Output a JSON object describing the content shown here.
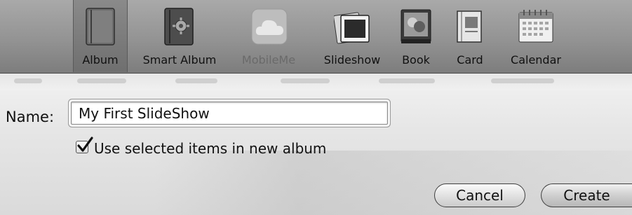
{
  "toolbar": {
    "items": [
      {
        "label": "Album",
        "icon": "album-icon",
        "selected": true,
        "enabled": true
      },
      {
        "label": "Smart Album",
        "icon": "smart-album-icon",
        "selected": false,
        "enabled": true
      },
      {
        "label": "MobileMe",
        "icon": "mobileme-cloud-icon",
        "selected": false,
        "enabled": false
      },
      {
        "label": "Slideshow",
        "icon": "slideshow-icon",
        "selected": false,
        "enabled": true
      },
      {
        "label": "Book",
        "icon": "book-icon",
        "selected": false,
        "enabled": true
      },
      {
        "label": "Card",
        "icon": "card-icon",
        "selected": false,
        "enabled": true
      },
      {
        "label": "Calendar",
        "icon": "calendar-icon",
        "selected": false,
        "enabled": true
      }
    ]
  },
  "form": {
    "name_label": "Name:",
    "name_value": "My First SlideShow",
    "checkbox_label": "Use selected items in new album",
    "checkbox_checked": true
  },
  "buttons": {
    "cancel_label": "Cancel",
    "create_label": "Create"
  }
}
